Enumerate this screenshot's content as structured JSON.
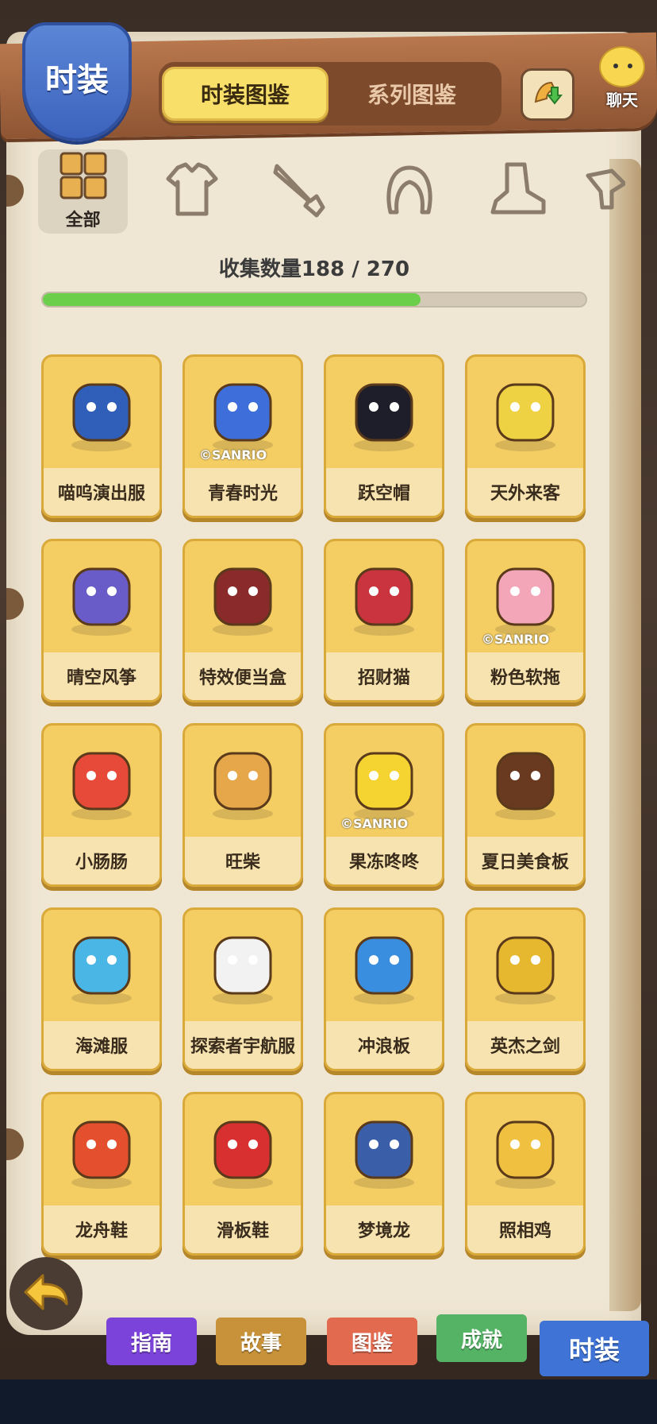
{
  "header": {
    "badge": "时装",
    "tabs": [
      {
        "label": "时装图鉴",
        "active": true
      },
      {
        "label": "系列图鉴",
        "active": false
      }
    ],
    "chat_label": "聊天"
  },
  "categories": [
    {
      "label": "全部",
      "icon": "grid-icon",
      "active": true
    },
    {
      "label": "",
      "icon": "shirt-icon",
      "active": false
    },
    {
      "label": "",
      "icon": "knife-icon",
      "active": false
    },
    {
      "label": "",
      "icon": "hair-icon",
      "active": false
    },
    {
      "label": "",
      "icon": "shoe-icon",
      "active": false
    },
    {
      "label": "",
      "icon": "pet-icon",
      "active": false
    }
  ],
  "collection": {
    "label": "收集数量188 / 270",
    "collected": 188,
    "total": 270
  },
  "items": [
    {
      "name": "喵呜演出服",
      "icon": "jacket-icon",
      "sanrio": ""
    },
    {
      "name": "青春时光",
      "icon": "overalls-icon",
      "sanrio": "©SANRIO"
    },
    {
      "name": "跃空帽",
      "icon": "ufo-hat-icon",
      "sanrio": ""
    },
    {
      "name": "天外来客",
      "icon": "space-capsule-icon",
      "sanrio": ""
    },
    {
      "name": "晴空风筝",
      "icon": "kite-icon",
      "sanrio": ""
    },
    {
      "name": "特效便当盒",
      "icon": "bento-icon",
      "sanrio": ""
    },
    {
      "name": "招财猫",
      "icon": "lucky-cat-icon",
      "sanrio": ""
    },
    {
      "name": "粉色软拖",
      "icon": "slipper-icon",
      "sanrio": "©SANRIO"
    },
    {
      "name": "小肠肠",
      "icon": "sausage-icon",
      "sanrio": ""
    },
    {
      "name": "旺柴",
      "icon": "shiba-icon",
      "sanrio": ""
    },
    {
      "name": "果冻咚咚",
      "icon": "jelly-icon",
      "sanrio": "©SANRIO"
    },
    {
      "name": "夏日美食板",
      "icon": "food-board-icon",
      "sanrio": ""
    },
    {
      "name": "海滩服",
      "icon": "beach-shirt-icon",
      "sanrio": ""
    },
    {
      "name": "探索者宇航服",
      "icon": "spacesuit-icon",
      "sanrio": ""
    },
    {
      "name": "冲浪板",
      "icon": "surfboard-icon",
      "sanrio": ""
    },
    {
      "name": "英杰之剑",
      "icon": "sword-icon",
      "sanrio": ""
    },
    {
      "name": "龙舟鞋",
      "icon": "dragon-shoe-icon",
      "sanrio": ""
    },
    {
      "name": "滑板鞋",
      "icon": "sneaker-icon",
      "sanrio": ""
    },
    {
      "name": "梦境龙",
      "icon": "dream-dragon-icon",
      "sanrio": ""
    },
    {
      "name": "照相鸡",
      "icon": "camera-chicken-icon",
      "sanrio": ""
    }
  ],
  "bottom_nav": [
    {
      "label": "指南",
      "color": "#7b43d9"
    },
    {
      "label": "故事",
      "color": "#c8923a"
    },
    {
      "label": "图鉴",
      "color": "#e26a4f"
    },
    {
      "label": "成就",
      "color": "#55b365"
    },
    {
      "label": "时装",
      "color": "#3f74d6"
    }
  ],
  "colors": {
    "card": "#f4cd63",
    "progress": "#6ccf4c",
    "tab_active": "#f7df6a"
  }
}
